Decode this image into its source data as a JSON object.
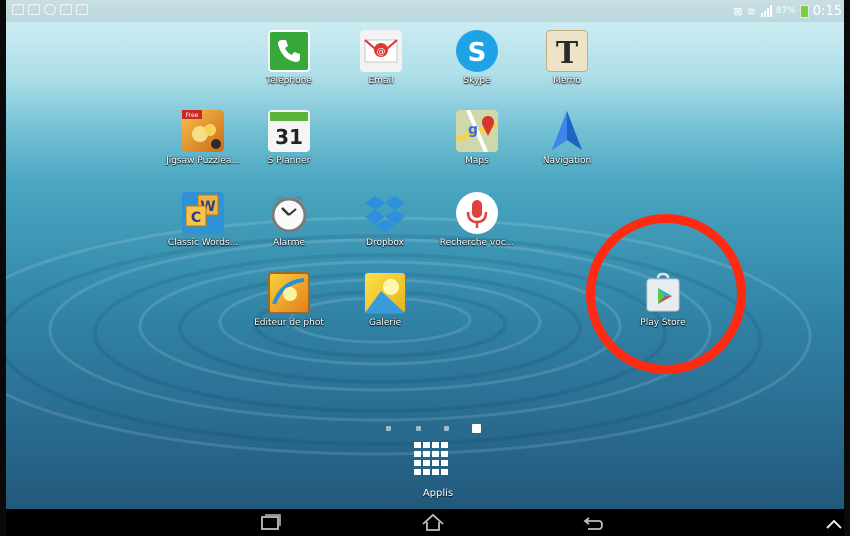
{
  "status_bar": {
    "notification_icons": [
      "image-icon",
      "picture-icon",
      "vk-icon",
      "upload-icon",
      "camera-icon"
    ],
    "battery_percent": "87%",
    "time": "0:15"
  },
  "home": {
    "apps": [
      {
        "label": "Téléphone",
        "icon": "phone-icon",
        "color": "#37a83a"
      },
      {
        "label": "Email",
        "icon": "email-icon",
        "color": "#f2f2f2"
      },
      {
        "label": "Skype",
        "icon": "skype-icon",
        "color": "#1ea4e6"
      },
      {
        "label": "Memo",
        "icon": "memo-icon",
        "color": "#ede3c6"
      },
      {
        "label": "Jigsaw Puzzlea...",
        "icon": "jigsaw-puzzle-icon",
        "color": "#d88b2a"
      },
      {
        "label": "S Planner",
        "icon": "calendar-icon",
        "color": "#f5f5f5",
        "badge": "31"
      },
      {
        "label": "Maps",
        "icon": "maps-icon",
        "color": "#cfd8a8"
      },
      {
        "label": "Navigation",
        "icon": "navigation-icon",
        "color": "#1f63c4"
      },
      {
        "label": "Classic Words...",
        "icon": "classic-words-icon",
        "color": "#2e92d8"
      },
      {
        "label": "Alarme",
        "icon": "alarm-icon",
        "color": "#f5f5f5"
      },
      {
        "label": "Dropbox",
        "icon": "dropbox-icon",
        "color": "#2d8fdd"
      },
      {
        "label": "Recherche voc...",
        "icon": "voice-search-icon",
        "color": "#ffffff"
      },
      {
        "label": "Editeur de phot",
        "icon": "photo-editor-icon",
        "color": "#f1a628"
      },
      {
        "label": "Galerie",
        "icon": "gallery-icon",
        "color": "#f4d02c"
      },
      {
        "label": "Play Store",
        "icon": "play-store-icon",
        "color": "#e9ecef"
      }
    ],
    "page_count": 4,
    "current_page": 4,
    "apps_button_label": "Applis"
  },
  "nav_bar": {
    "buttons": [
      "recent-apps-icon",
      "home-icon",
      "back-icon",
      "chevron-up-icon"
    ]
  },
  "highlight": {
    "color": "#ff2a12",
    "target": "Play Store"
  }
}
